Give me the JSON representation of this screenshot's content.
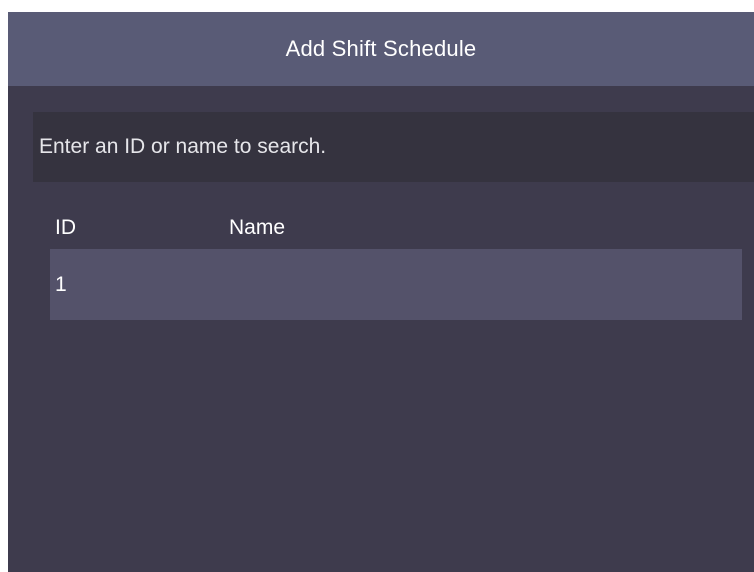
{
  "header": {
    "title": "Add Shift Schedule"
  },
  "search": {
    "placeholder": "Enter an ID or name to search."
  },
  "table": {
    "columns": [
      "ID",
      "Name"
    ],
    "rows": [
      {
        "id": "1",
        "name": ""
      }
    ]
  },
  "colors": {
    "background": "#3e3b4d",
    "header": "#595b76",
    "search_field": "#35333f",
    "row_highlight": "#54526a",
    "text": "#ffffff"
  }
}
